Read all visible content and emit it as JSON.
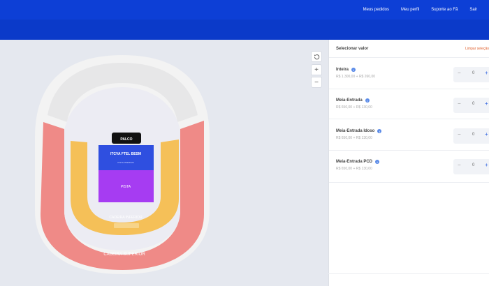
{
  "nav": {
    "items": [
      "Meus pedidos",
      "Meu perfil",
      "Suporte ao Fã",
      "Sair"
    ]
  },
  "map": {
    "controls": {
      "reset_icon": "rotate-ccw-icon",
      "zoom_in": "+",
      "zoom_out": "−"
    },
    "sections": {
      "palco": "PALCO",
      "pista_premium": "ITCVA FTEL BESM",
      "pista_premium_sub": "PISTA PREMIUM",
      "pista": "PISTA",
      "cadeira_inferior": "CADEIRA INFERIOR",
      "cadeira_superior": "CADEIRA SUPERIOR"
    },
    "colors": {
      "cadeira_superior": "#ef8a87",
      "cadeira_inferior": "#f5c058",
      "pista": "#a63cf2",
      "pista_premium": "#2f4fe0",
      "palco": "#111111",
      "unavailable": "#e9e9ea"
    }
  },
  "panel": {
    "title": "Selecionar valor",
    "clear": "Limpar seleção",
    "tickets": [
      {
        "name": "Inteira",
        "price": "R$ 1.300,00 + R$ 260,00",
        "qty": "0"
      },
      {
        "name": "Meia-Entrada",
        "price": "R$ 650,00 + R$ 130,00",
        "qty": "0"
      },
      {
        "name": "Meia-Entrada Idoso",
        "price": "R$ 650,00 + R$ 130,00",
        "qty": "0"
      },
      {
        "name": "Meia-Entrada PCD",
        "price": "R$ 650,00 + R$ 130,00",
        "qty": "0"
      }
    ],
    "minus": "−",
    "plus": "+"
  }
}
